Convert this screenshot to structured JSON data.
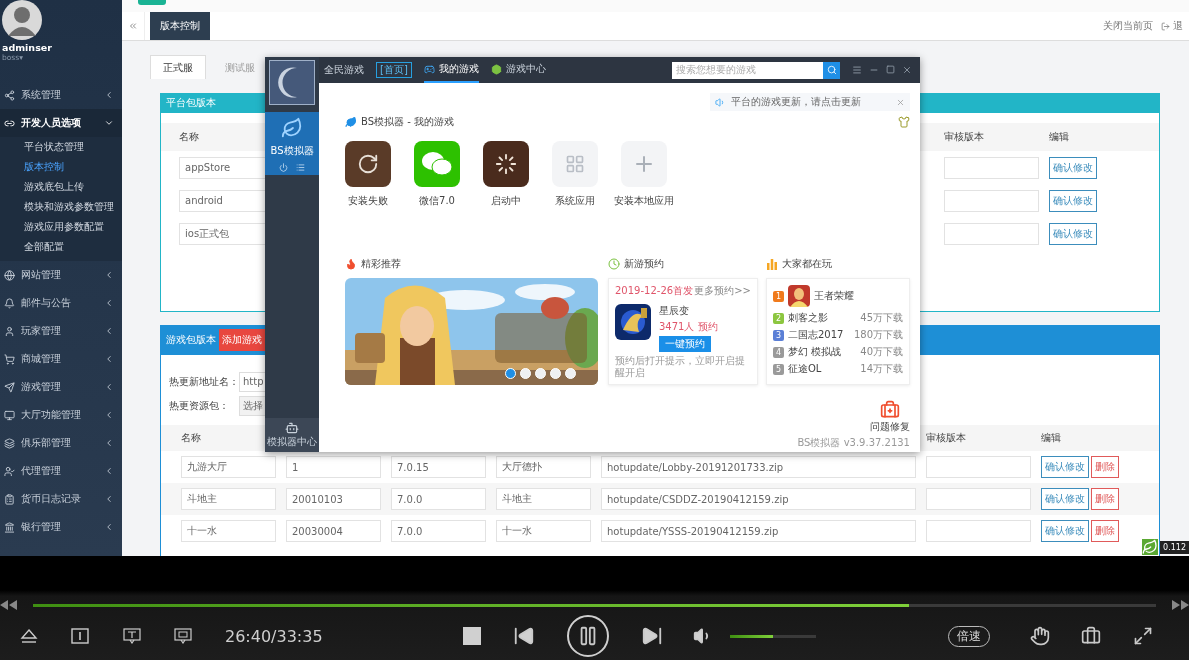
{
  "sidebar": {
    "username": "adminser",
    "role": "boss▾",
    "menu": [
      {
        "label": "系统管理",
        "expanded": false
      },
      {
        "label": "开发人员选项",
        "expanded": true,
        "children": [
          {
            "label": "平台状态管理",
            "selected": false
          },
          {
            "label": "版本控制",
            "selected": true
          },
          {
            "label": "游戏底包上传",
            "selected": false
          },
          {
            "label": "模块和游戏参数管理",
            "selected": false
          },
          {
            "label": "游戏应用参数配置",
            "selected": false
          },
          {
            "label": "全部配置",
            "selected": false
          }
        ]
      },
      {
        "label": "网站管理",
        "expanded": false
      },
      {
        "label": "邮件与公告",
        "expanded": false
      },
      {
        "label": "玩家管理",
        "expanded": false
      },
      {
        "label": "商城管理",
        "expanded": false
      },
      {
        "label": "游戏管理",
        "expanded": false
      },
      {
        "label": "大厅功能管理",
        "expanded": false
      },
      {
        "label": "俱乐部管理",
        "expanded": false
      },
      {
        "label": "代理管理",
        "expanded": false
      },
      {
        "label": "货币日志记录",
        "expanded": false
      },
      {
        "label": "银行管理",
        "expanded": false
      }
    ]
  },
  "tab_bar": {
    "tabs": [
      {
        "label": "版本控制",
        "selected": true
      }
    ],
    "close_page": "关闭当前页",
    "logout": "退"
  },
  "sub_tabs": [
    {
      "label": "正式服",
      "selected": true
    },
    {
      "label": "测试服",
      "selected": false
    }
  ],
  "platform_panel": {
    "title": "平台包版本",
    "columns": [
      "名称",
      "审核版本",
      "编辑"
    ],
    "rows": [
      {
        "name": "appStore",
        "action": "确认修改"
      },
      {
        "name": "android",
        "action": "确认修改"
      },
      {
        "name": "ios正式包",
        "action": "确认修改"
      }
    ]
  },
  "game_panel": {
    "title": "游戏包版本",
    "add_button": "添加游戏",
    "form": [
      {
        "label": "热更新地址名：",
        "value": "http",
        "kind": "input"
      },
      {
        "label": "热更资源包：",
        "value": "选择",
        "kind": "select"
      }
    ],
    "columns": [
      "名称",
      "审核版本",
      "编辑"
    ],
    "rows": [
      {
        "cells": [
          "九游大厅",
          "1",
          "7.0.15",
          "大厅德扑",
          "hotupdate/Lobby-20191201733.zip"
        ],
        "confirm": "确认修改",
        "delete": "删除"
      },
      {
        "cells": [
          "斗地主",
          "20010103",
          "7.0.0",
          "斗地主",
          "hotupdate/CSDDZ-20190412159.zip"
        ],
        "confirm": "确认修改",
        "delete": "删除"
      },
      {
        "cells": [
          "十一水",
          "20030004",
          "7.0.0",
          "十一水",
          "hotupdate/YSSS-20190412159.zip"
        ],
        "confirm": "确认修改",
        "delete": "删除"
      }
    ]
  },
  "app_window": {
    "rail": {
      "items": [
        {
          "label": "BS模拟器",
          "selected": true
        }
      ],
      "bottom": "模拟器中心"
    },
    "topbar": {
      "title": "全民游戏",
      "home": "[首页]",
      "tabs": [
        {
          "label": "我的游戏",
          "selected": true
        },
        {
          "label": "游戏中心",
          "selected": false
        }
      ],
      "search_placeholder": "搜索您想要的游戏"
    },
    "notice": "平台的游戏更新，请点击更新",
    "my_games_title": "BS模拟器 - 我的游戏",
    "apps": [
      {
        "label": "安装失败",
        "kind": "failed"
      },
      {
        "label": "微信7.0",
        "kind": "wechat"
      },
      {
        "label": "启动中",
        "kind": "loading"
      },
      {
        "label": "系统应用",
        "kind": "system"
      },
      {
        "label": "安装本地应用",
        "kind": "add"
      }
    ],
    "featured": {
      "title": "精彩推荐",
      "slides": [
        {
          "selected": true
        },
        {
          "selected": false
        },
        {
          "selected": false
        },
        {
          "selected": false
        },
        {
          "selected": false
        }
      ]
    },
    "preorder": {
      "title": "新游预约",
      "date": "2019-12-26首发",
      "more": "更多预约>>",
      "game": "星辰变",
      "count": "3471人 预约",
      "button": "一键预约",
      "note": "预约后打开提示，立即开启提醒开启"
    },
    "popular": {
      "title": "大家都在玩",
      "items": [
        {
          "rank": "1",
          "name": "王者荣耀",
          "kind": "featured",
          "color": "#f07a1c"
        },
        {
          "rank": "2",
          "name": "刺客之影",
          "downloads": "45万下载",
          "kind": "plain",
          "color": "#8cc63f"
        },
        {
          "rank": "3",
          "name": "二国志2017",
          "downloads": "180万下载",
          "kind": "plain",
          "color": "#5b7fd6"
        },
        {
          "rank": "4",
          "name": "梦幻 模拟战",
          "downloads": "40万下载",
          "kind": "plain",
          "color": "#9a9a9a"
        },
        {
          "rank": "5",
          "name": "征途OL",
          "downloads": "14万下载",
          "kind": "plain",
          "color": "#9a9a9a"
        }
      ]
    },
    "repair": "问题修复",
    "version": "BS模拟器 v3.9.37.2131"
  },
  "tray": {
    "text": "0.112"
  },
  "player": {
    "progress": {
      "level": 0.78
    },
    "time": "26:40/33:35",
    "playing": true,
    "volume": {
      "level": 0.5
    },
    "speed": "倍速"
  }
}
